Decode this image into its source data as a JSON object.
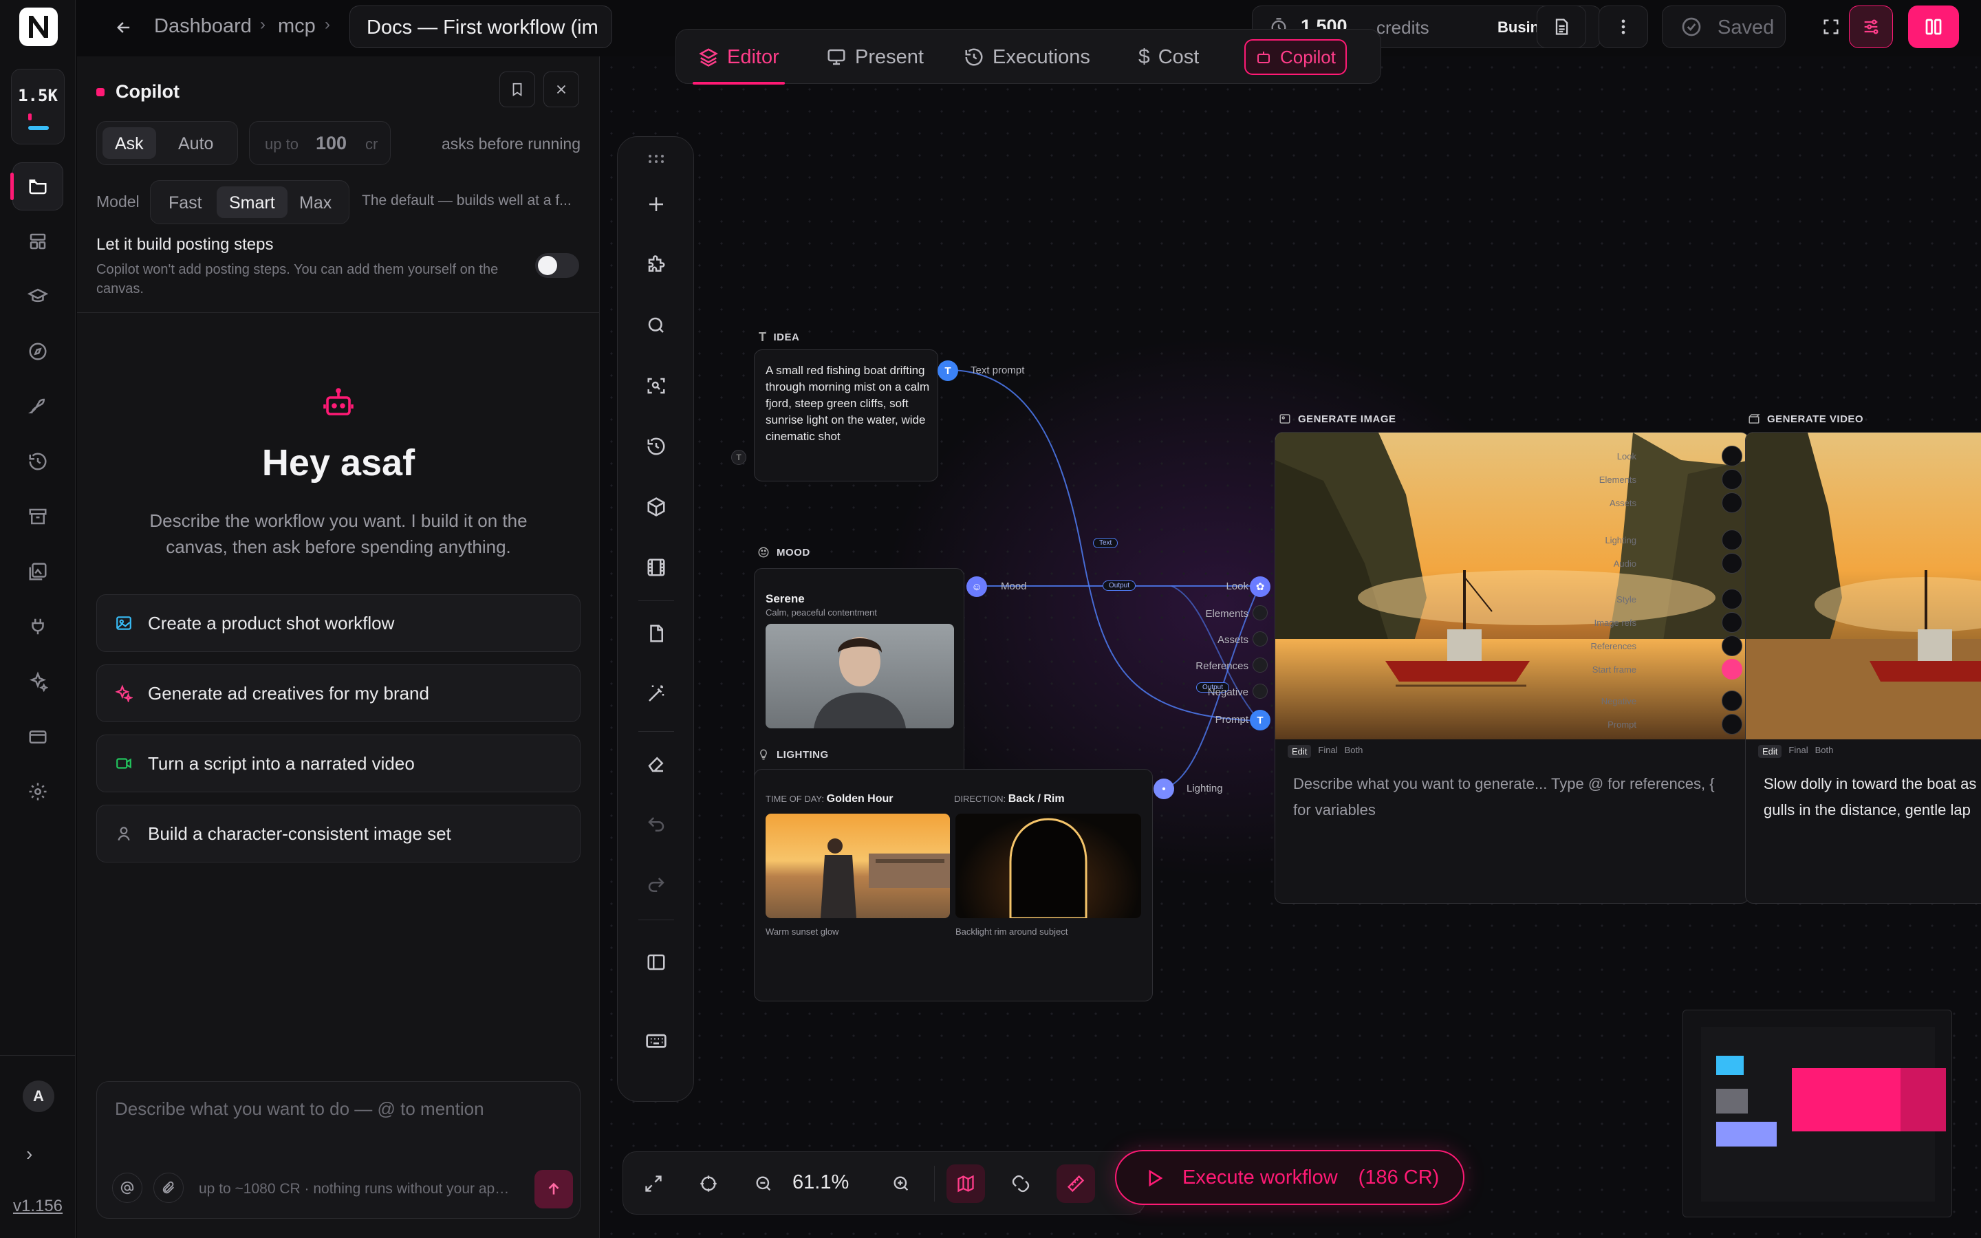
{
  "rail": {
    "credit_value": "1.5K",
    "avatar_letter": "A",
    "version": "v1.156"
  },
  "topbar": {
    "breadcrumb": [
      "Dashboard",
      "mcp"
    ],
    "doc_title": "Docs — First workflow (im",
    "credits_amount": "1,500",
    "credits_label": "credits",
    "plan": "Business",
    "saved_label": "Saved"
  },
  "tabs": [
    {
      "label": "Editor",
      "icon": "layers-icon"
    },
    {
      "label": "Present",
      "icon": "monitor-icon"
    },
    {
      "label": "Executions",
      "icon": "history-icon"
    },
    {
      "label": "Cost",
      "icon": "dollar-icon"
    },
    {
      "label": "Copilot",
      "icon": "bot-icon"
    }
  ],
  "copilot": {
    "title": "Copilot",
    "mode_options": [
      "Ask",
      "Auto"
    ],
    "mode_selected": "Ask",
    "limit_prefix": "up to",
    "limit_value": "100",
    "limit_unit": "cr",
    "mode_hint": "asks before running",
    "model_label": "Model",
    "model_options": [
      "Fast",
      "Smart",
      "Max"
    ],
    "model_selected": "Smart",
    "model_hint": "The default — builds well at a f...",
    "posting_title": "Let it build posting steps",
    "posting_desc": "Copilot won't add posting steps. You can add them yourself on the canvas.",
    "greeting": "Hey asaf",
    "description": "Describe the workflow you want. I build it on the canvas, then ask before spending anything.",
    "suggestions": [
      {
        "label": "Create a product shot workflow",
        "icon": "image-icon",
        "color": "#38bdf8"
      },
      {
        "label": "Generate ad creatives for my brand",
        "icon": "sparkle-icon",
        "color": "#ff3d8a"
      },
      {
        "label": "Turn a script into a narrated video",
        "icon": "video-icon",
        "color": "#22c55e"
      },
      {
        "label": "Build a character-consistent image set",
        "icon": "person-icon",
        "color": "#8a8a92"
      }
    ],
    "composer_placeholder": "Describe what you want to do — @ to mention",
    "composer_footer": "up to ~1080 CR · nothing runs without your approval"
  },
  "canvas": {
    "idea": {
      "label": "IDEA",
      "text": "A small red fishing boat drifting through morning mist on a calm fjord, steep green cliffs, soft sunrise light on the water, wide cinematic shot",
      "port_label": "Text prompt"
    },
    "mood": {
      "label": "MOOD",
      "title": "Serene",
      "subtitle": "Calm, peaceful contentment",
      "port_label": "Mood"
    },
    "lighting": {
      "label": "LIGHTING",
      "time_key": "TIME OF DAY:",
      "time_value": "Golden Hour",
      "dir_key": "DIRECTION:",
      "dir_value": "Back / Rim",
      "time_caption": "Warm sunset glow",
      "dir_caption": "Backlight rim around subject",
      "port_label": "Lighting"
    },
    "edge_labels": {
      "text": "Text",
      "output1": "Output",
      "output2": "Output"
    },
    "inputs": [
      "Look",
      "Elements",
      "Assets",
      "References",
      "Negative",
      "Prompt"
    ],
    "generate_image": {
      "label": "GENERATE IMAGE",
      "mini_tabs": [
        "Edit",
        "Final",
        "Both"
      ],
      "prompt_placeholder": "Describe what you want to generate... Type @ for references, { for variables",
      "side_labels": [
        "Look",
        "Elements",
        "Assets",
        "Lighting",
        "Audio",
        "Style",
        "Image refs",
        "References",
        "Start frame",
        "Negative",
        "Prompt"
      ]
    },
    "generate_video": {
      "label": "GENERATE VIDEO",
      "mini_tabs": [
        "Edit",
        "Final",
        "Both"
      ],
      "prompt": "Slow dolly in toward the boat as gulls in the distance, gentle lap"
    },
    "zoom": "61.1%",
    "execute_label": "Execute workflow",
    "execute_cost": "(186 CR)"
  }
}
